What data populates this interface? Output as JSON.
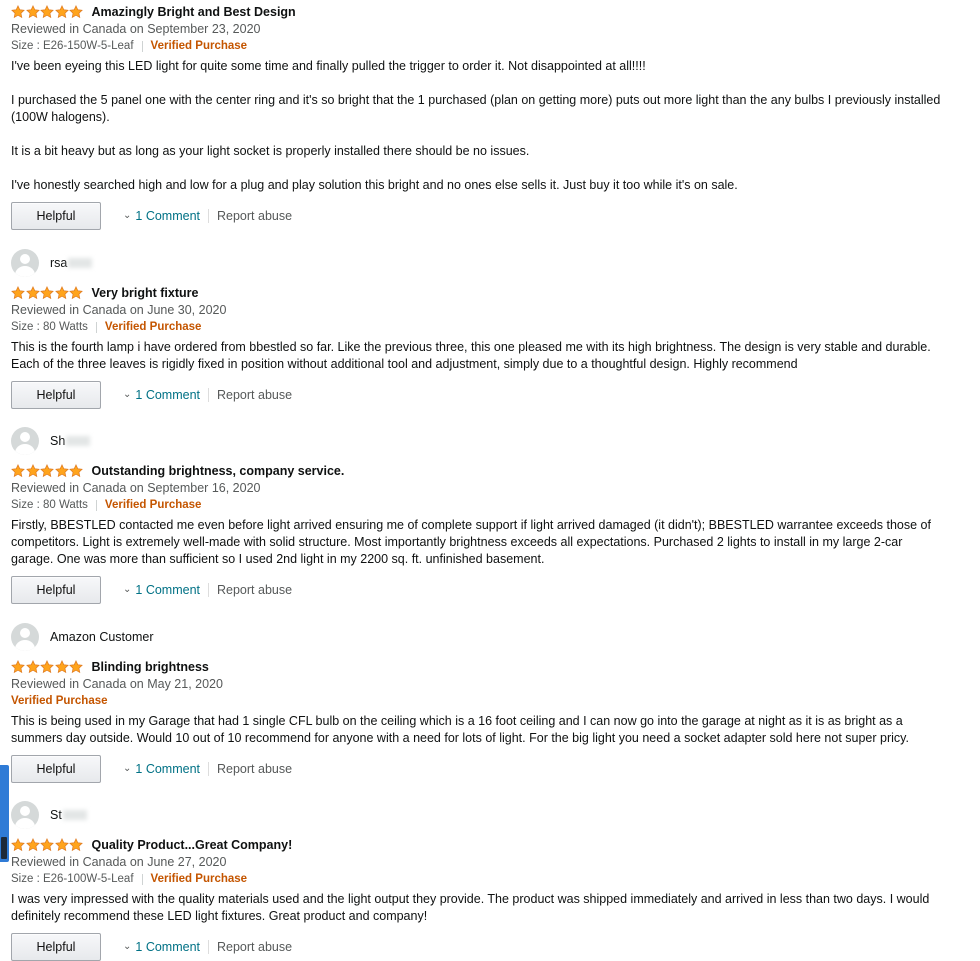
{
  "colors": {
    "star": "#ffa41c",
    "verified": "#c45500",
    "link": "#007185",
    "meta": "#565959"
  },
  "rating_icon": "star-icon",
  "reviews": [
    {
      "name": "",
      "name_blurred": false,
      "stars": 5,
      "title": "Amazingly Bright and Best Design",
      "date": "Reviewed in Canada on September 23, 2020",
      "size": "Size : E26-150W-5-Leaf",
      "verified": "Verified Purchase",
      "paragraphs": [
        "I've been eyeing this LED light for quite some time and finally pulled the trigger to order it. Not disappointed at all!!!!",
        "I purchased the 5 panel one with the center ring and it's so bright that the 1 purchased (plan on getting more) puts out more light than the any bulbs I previously installed (100W halogens).",
        "It is a bit heavy but as long as your light socket is properly installed there should be no issues.",
        "I've honestly searched high and low for a plug and play solution this bright and no ones else sells it. Just buy it too while it's on sale."
      ],
      "helpful": "Helpful",
      "comment": "1 Comment",
      "report": "Report abuse"
    },
    {
      "name": "rsa",
      "name_blurred": true,
      "stars": 5,
      "title": "Very bright fixture",
      "date": "Reviewed in Canada on June 30, 2020",
      "size": "Size : 80 Watts",
      "verified": "Verified Purchase",
      "paragraphs": [
        "This is the fourth lamp i have ordered from bbestled so far. Like the previous three, this one pleased me with its high brightness. The design is very stable and durable. Each of the three leaves is rigidly fixed in position without additional tool and adjustment, simply due to a thoughtful design. Highly recommend"
      ],
      "helpful": "Helpful",
      "comment": "1 Comment",
      "report": "Report abuse"
    },
    {
      "name": "Sh",
      "name_blurred": true,
      "stars": 5,
      "title": "Outstanding brightness, company service.",
      "date": "Reviewed in Canada on September 16, 2020",
      "size": "Size : 80 Watts",
      "verified": "Verified Purchase",
      "paragraphs": [
        "Firstly, BBESTLED contacted me even before light arrived ensuring me of complete support if light arrived damaged (it didn't); BBESTLED warrantee exceeds those of competitors. Light is extremely well-made with solid structure. Most importantly brightness exceeds all expectations. Purchased 2 lights to install in my large 2-car garage. One was more than sufficient so I used 2nd light in my 2200 sq. ft. unfinished basement."
      ],
      "helpful": "Helpful",
      "comment": "1 Comment",
      "report": "Report abuse"
    },
    {
      "name": "Amazon Customer",
      "name_blurred": false,
      "stars": 5,
      "title": "Blinding brightness",
      "date": "Reviewed in Canada on May 21, 2020",
      "size": "",
      "verified": "Verified Purchase",
      "paragraphs": [
        "This is being used in my Garage that had 1 single CFL bulb on the ceiling which is a 16 foot ceiling and I can now go into the garage at night as it is as bright as a summers day outside. Would 10 out of 10 recommend for anyone with a need for lots of light. For the big light you need a socket adapter sold here not super pricy."
      ],
      "helpful": "Helpful",
      "comment": "1 Comment",
      "report": "Report abuse"
    },
    {
      "name": "St",
      "name_blurred": true,
      "stars": 5,
      "title": "Quality Product...Great Company!",
      "date": "Reviewed in Canada on June 27, 2020",
      "size": "Size : E26-100W-5-Leaf",
      "verified": "Verified Purchase",
      "paragraphs": [
        "I was very impressed with the quality materials used and the light output they provide. The product was shipped immediately and arrived in less than two days. I would definitely recommend these LED light fixtures. Great product and company!"
      ],
      "helpful": "Helpful",
      "comment": "1 Comment",
      "report": "Report abuse"
    }
  ]
}
